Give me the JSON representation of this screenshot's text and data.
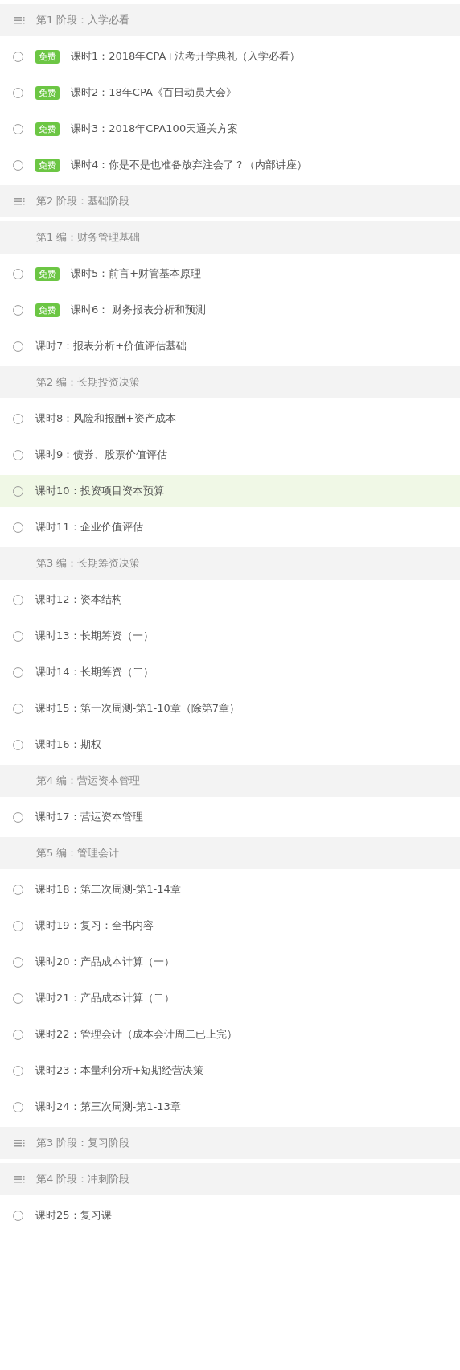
{
  "items": [
    {
      "kind": "stage",
      "title": "第1 阶段：入学必看"
    },
    {
      "kind": "lesson",
      "tag": "免费",
      "title": "课时1：2018年CPA+法考开学典礼（入学必看）",
      "selected": false
    },
    {
      "kind": "lesson",
      "tag": "免费",
      "title": "课时2：18年CPA《百日动员大会》",
      "selected": false
    },
    {
      "kind": "lesson",
      "tag": "免费",
      "title": "课时3：2018年CPA100天通关方案",
      "selected": false
    },
    {
      "kind": "lesson",
      "tag": "免费",
      "title": "课时4：你是不是也准备放弃注会了？（内部讲座）",
      "selected": false
    },
    {
      "kind": "stage",
      "title": "第2 阶段：基础阶段"
    },
    {
      "kind": "section",
      "title": "第1 编：财务管理基础"
    },
    {
      "kind": "lesson",
      "tag": "免费",
      "title": "课时5：前言+财管基本原理",
      "selected": false
    },
    {
      "kind": "lesson",
      "tag": "免费",
      "title": "课时6： 财务报表分析和预测",
      "selected": false
    },
    {
      "kind": "lesson",
      "title": "课时7：报表分析+价值评估基础",
      "selected": false
    },
    {
      "kind": "section",
      "title": "第2 编：长期投资决策"
    },
    {
      "kind": "lesson",
      "title": "课时8：风险和报酬+资产成本",
      "selected": false
    },
    {
      "kind": "lesson",
      "title": "课时9：债券、股票价值评估",
      "selected": false
    },
    {
      "kind": "lesson",
      "title": "课时10：投资项目资本预算",
      "selected": true
    },
    {
      "kind": "lesson",
      "title": "课时11：企业价值评估",
      "selected": false
    },
    {
      "kind": "section",
      "title": "第3 编：长期筹资决策"
    },
    {
      "kind": "lesson",
      "title": "课时12：资本结构",
      "selected": false
    },
    {
      "kind": "lesson",
      "title": "课时13：长期筹资（一）",
      "selected": false
    },
    {
      "kind": "lesson",
      "title": "课时14：长期筹资（二）",
      "selected": false
    },
    {
      "kind": "lesson",
      "title": "课时15：第一次周测-第1-10章（除第7章）",
      "selected": false
    },
    {
      "kind": "lesson",
      "title": "课时16：期权",
      "selected": false
    },
    {
      "kind": "section",
      "title": "第4 编：营运资本管理"
    },
    {
      "kind": "lesson",
      "title": "课时17：营运资本管理",
      "selected": false
    },
    {
      "kind": "section",
      "title": "第5 编：管理会计"
    },
    {
      "kind": "lesson",
      "title": "课时18：第二次周测-第1-14章",
      "selected": false
    },
    {
      "kind": "lesson",
      "title": "课时19：复习：全书内容",
      "selected": false
    },
    {
      "kind": "lesson",
      "title": "课时20：产品成本计算（一）",
      "selected": false
    },
    {
      "kind": "lesson",
      "title": "课时21：产品成本计算（二）",
      "selected": false
    },
    {
      "kind": "lesson",
      "title": "课时22：管理会计（成本会计周二已上完）",
      "selected": false
    },
    {
      "kind": "lesson",
      "title": "课时23：本量利分析+短期经营决策",
      "selected": false
    },
    {
      "kind": "lesson",
      "title": "课时24：第三次周测-第1-13章",
      "selected": false
    },
    {
      "kind": "stage",
      "title": "第3 阶段：复习阶段"
    },
    {
      "kind": "stage",
      "title": "第4 阶段：冲刺阶段"
    },
    {
      "kind": "lesson",
      "title": "课时25：复习课",
      "selected": false
    }
  ]
}
